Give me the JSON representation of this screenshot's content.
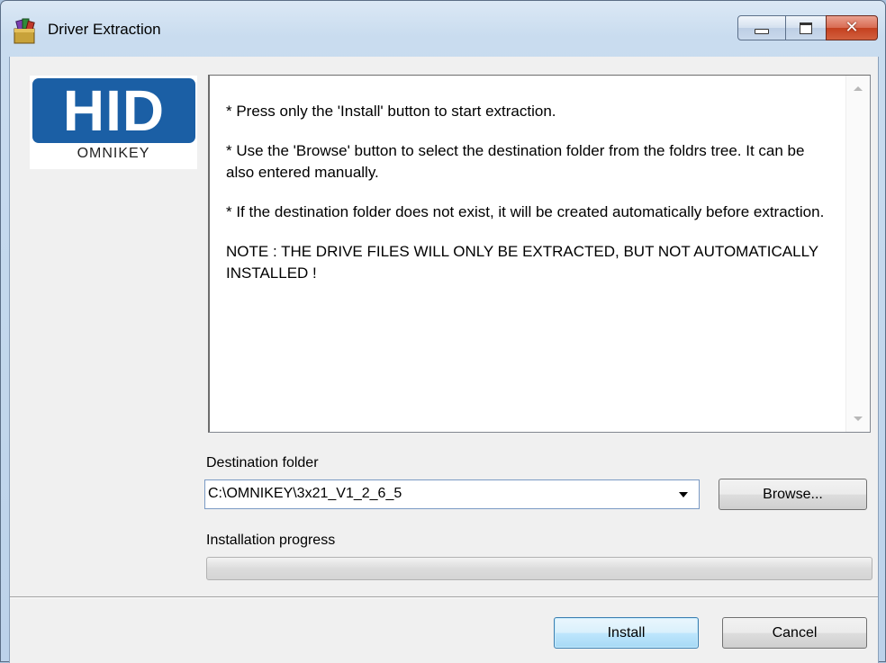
{
  "window": {
    "title": "Driver Extraction",
    "icon": "installer-boxes-icon",
    "controls": [
      "minimize-icon",
      "maximize-icon",
      "close-icon"
    ],
    "close_glyph": "✕"
  },
  "logo": {
    "brand": "HID",
    "sub": "OMNIKEY",
    "color": "#1b5fa5"
  },
  "info": {
    "lines": [
      "* Press only the 'Install' button to start extraction.",
      "* Use the 'Browse' button to select the destination folder from the foldrs tree. It can be also entered manually.",
      "* If the destination folder does not exist, it will be created automatically before extraction.",
      "NOTE : THE DRIVE FILES WILL ONLY BE EXTRACTED, BUT NOT AUTOMATICALLY INSTALLED !"
    ]
  },
  "destination": {
    "label": "Destination folder",
    "value": "C:\\OMNIKEY\\3x21_V1_2_6_5",
    "browse_label": "Browse..."
  },
  "progress": {
    "label": "Installation progress",
    "fraction": 0
  },
  "buttons": {
    "install_label": "Install",
    "cancel_label": "Cancel"
  }
}
